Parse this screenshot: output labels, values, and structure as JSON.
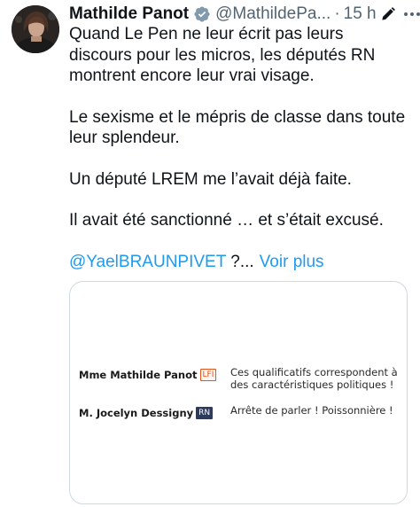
{
  "tweet": {
    "display_name": "Mathilde Panot",
    "handle": "@MathildePa...",
    "separator": "·",
    "time": "15 h",
    "paragraphs": [
      "Quand Le Pen ne leur écrit pas leurs discours pour les micros, les députés RN montrent encore leur vrai visage.",
      "Le sexisme et le mépris de classe dans toute leur splendeur.",
      "Un député LREM me l’avait déjà faite.",
      "Il avait été sanctionné … et s’était excusé."
    ],
    "mention": "@YaelBRAUNPIVET",
    "truncation": "?...",
    "show_more": "Voir plus",
    "icons": {
      "verified": "verified-badge-icon",
      "edit": "edited-pencil-icon",
      "more": "more-options-icon"
    }
  },
  "card": {
    "rows": [
      {
        "speaker": "Mme Mathilde Panot",
        "party": "LFI",
        "quote": "Ces qualificatifs correspondent à des caractéristiques politiques !"
      },
      {
        "speaker": "M. Jocelyn Dessigny",
        "party": "RN",
        "quote": "Arrête de parler ! Poissonnière !"
      }
    ]
  },
  "colors": {
    "text": "#0f1419",
    "secondary": "#536471",
    "link": "#1d9bf0",
    "border": "#cfd9de",
    "lfi": "#e2541c",
    "rn": "#2d3a5c"
  }
}
